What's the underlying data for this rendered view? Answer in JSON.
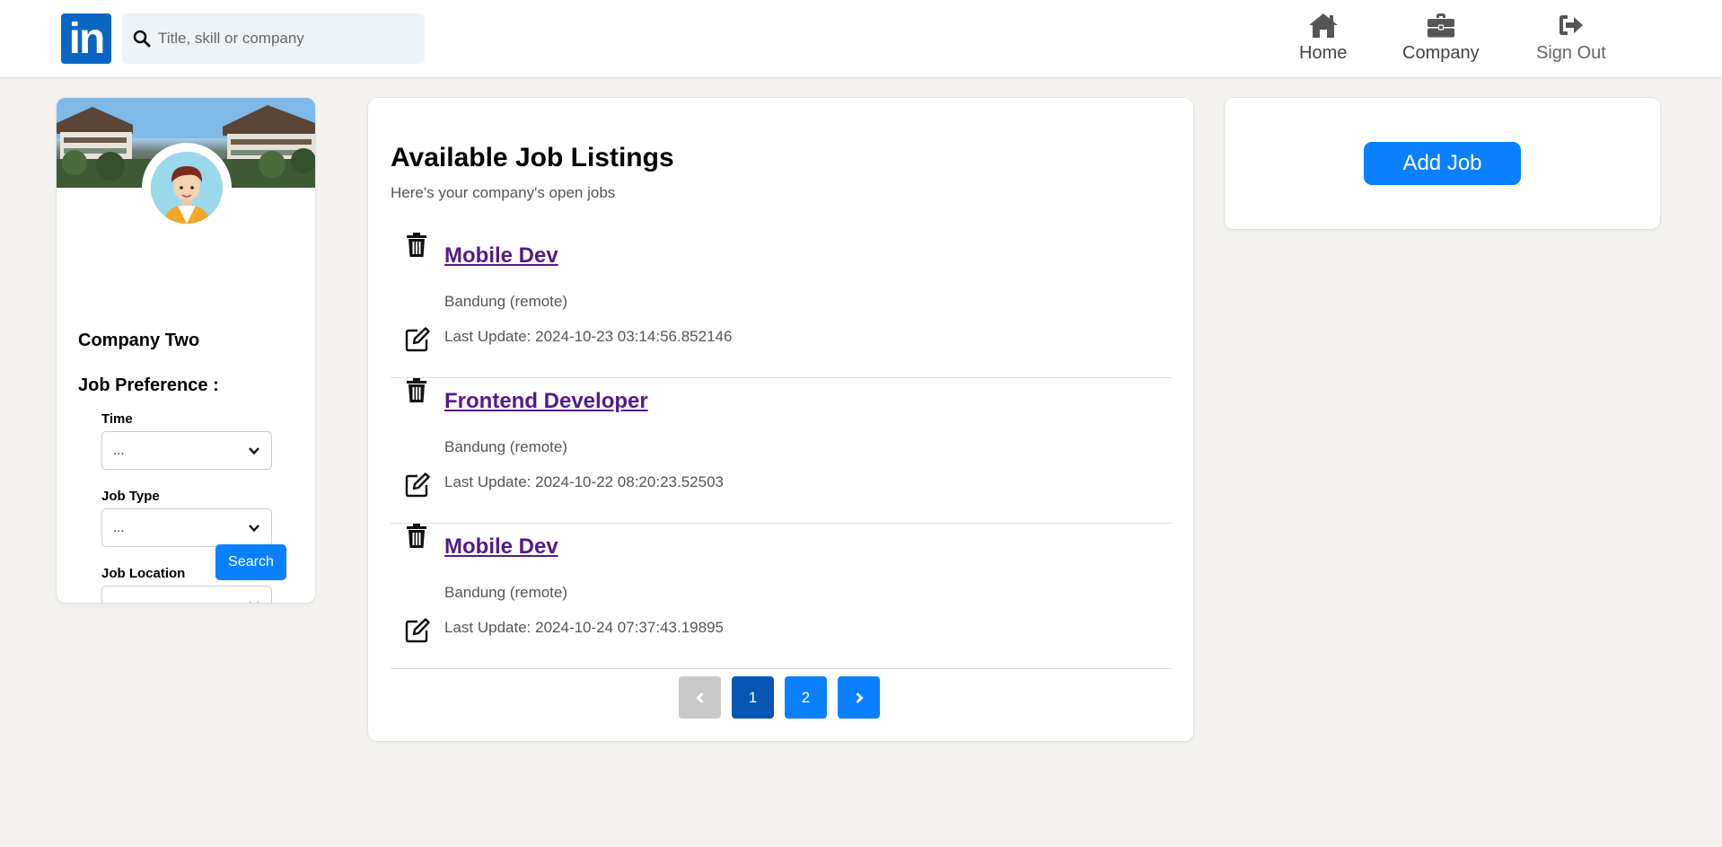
{
  "header": {
    "logo_text": "in",
    "search_placeholder": "Title, skill or company",
    "nav": {
      "home": "Home",
      "company": "Company",
      "sign_out": "Sign Out"
    }
  },
  "profile": {
    "company_name": "Company Two",
    "preference_title": "Job Preference :",
    "fields": [
      {
        "label": "Time",
        "value": "..."
      },
      {
        "label": "Job Type",
        "value": "..."
      },
      {
        "label": "Job Location",
        "value": "..."
      }
    ],
    "search_button": "Search"
  },
  "jobs": {
    "title": "Available Job Listings",
    "subtitle": "Here's your company's open jobs",
    "items": [
      {
        "title": "Mobile Dev",
        "location": "Bandung (remote)",
        "updated": "Last Update: 2024-10-23 03:14:56.852146"
      },
      {
        "title": "Frontend Developer",
        "location": "Bandung (remote)",
        "updated": "Last Update: 2024-10-22 08:20:23.52503"
      },
      {
        "title": "Mobile Dev",
        "location": "Bandung (remote)",
        "updated": "Last Update: 2024-10-24 07:37:43.19895"
      }
    ],
    "pagination": {
      "pages": [
        "1",
        "2"
      ],
      "current": "1"
    }
  },
  "actions": {
    "add_job": "Add Job"
  },
  "colors": {
    "brand": "#0a66c2",
    "primary_button": "#0a80ff",
    "link_visited": "#551a8b",
    "background": "#f3f2ef"
  }
}
